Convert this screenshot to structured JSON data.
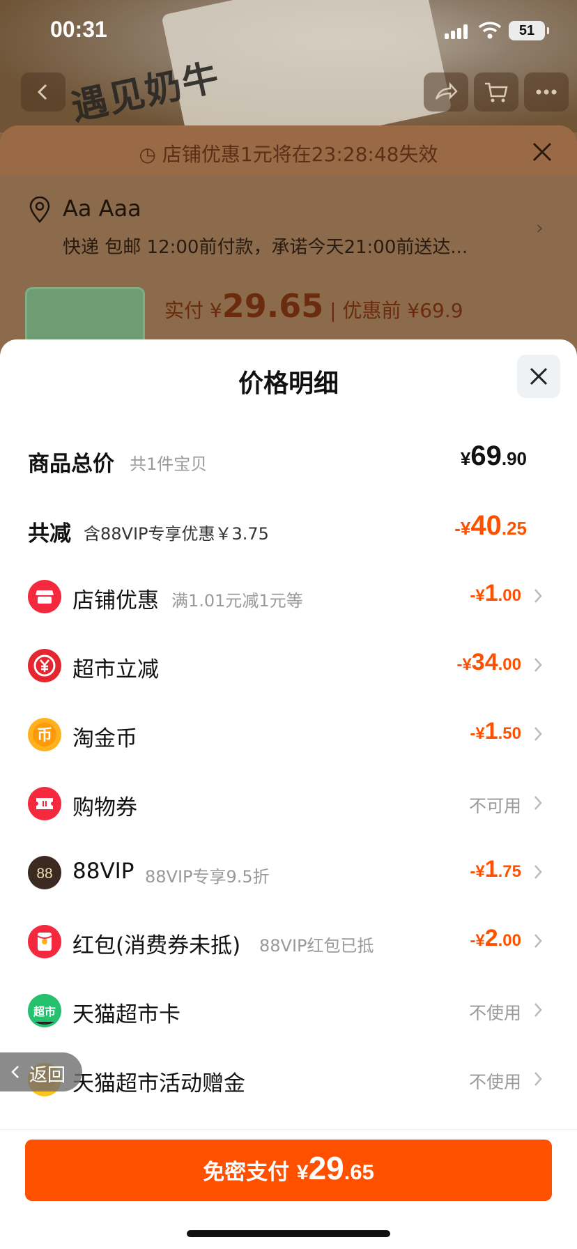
{
  "status_bar": {
    "time": "00:31",
    "battery": "51"
  },
  "background": {
    "product_box_text": "遇见奶牛",
    "promo_banner": "店铺优惠1元将在23:28:48失效",
    "address_name": "Aa Aaa",
    "address_desc": "快递 包邮 12:00前付款，承诺今天21:00前送达...",
    "price_prefix": "实付 ¥",
    "price_value": "29.65",
    "price_before": "优惠前 ¥69.9"
  },
  "sheet": {
    "title": "价格明细",
    "total": {
      "label": "商品总价",
      "sub": "共1件宝贝",
      "sym": "¥",
      "int": "69",
      "dec": ".90"
    },
    "reduction": {
      "label": "共减",
      "sub": "含88VIP专享优惠￥3.75",
      "sym": "-¥",
      "int": "40",
      "dec": ".25"
    },
    "items": [
      {
        "label": "店铺优惠",
        "sub": "满1.01元减1元等",
        "sym": "-¥",
        "int": "1",
        "dec": ".00",
        "status": ""
      },
      {
        "label": "超市立减",
        "sub": "",
        "sym": "-¥",
        "int": "34",
        "dec": ".00",
        "status": ""
      },
      {
        "label": "淘金币",
        "sub": "",
        "sym": "-¥",
        "int": "1",
        "dec": ".50",
        "status": ""
      },
      {
        "label": "购物券",
        "sub": "",
        "sym": "",
        "int": "",
        "dec": "",
        "status": "不可用"
      },
      {
        "label": "88VIP",
        "sub": "88VIP专享9.5折",
        "sym": "-¥",
        "int": "1",
        "dec": ".75",
        "status": ""
      },
      {
        "label": "红包(消费券未抵)",
        "sub": "88VIP红包已抵",
        "sym": "-¥",
        "int": "2",
        "dec": ".00",
        "status": ""
      },
      {
        "label": "天猫超市卡",
        "sub": "",
        "sym": "",
        "int": "",
        "dec": "",
        "status": "不使用"
      },
      {
        "label": "天猫超市活动赠金",
        "sub": "",
        "sym": "",
        "int": "",
        "dec": "",
        "status": "不使用"
      }
    ],
    "icons": {
      "shop": "shop-icon",
      "supermarket": "yuan-badge-icon",
      "coin": "coin-icon",
      "voucher": "ticket-icon",
      "vip": "vip-88-icon",
      "redpacket": "red-packet-icon",
      "card": "tmall-supermarket-icon",
      "bonus": "gift-coin-icon"
    },
    "icon_glyphs": {
      "coin": "币",
      "vip": "88",
      "card": "超市"
    }
  },
  "back_pill": {
    "label": "返回"
  },
  "pay": {
    "label": "免密支付 ",
    "sym": "¥",
    "int": "29",
    "dec": ".65"
  },
  "colors": {
    "accent": "#ff5000",
    "muted": "#999999",
    "text": "#111111"
  }
}
